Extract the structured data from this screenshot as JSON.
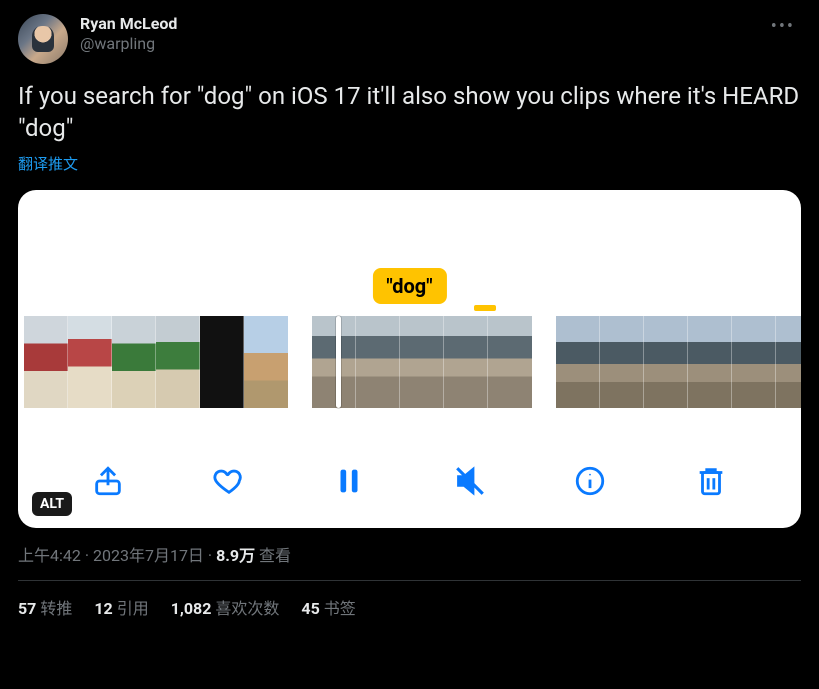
{
  "author": {
    "display_name": "Ryan McLeod",
    "username": "@warpling"
  },
  "tweet_text": "If you search for \"dog\" on iOS 17 it'll also show you clips where it's HEARD \"dog\"",
  "translate_label": "翻译推文",
  "media": {
    "search_badge": "\"dog\"",
    "alt_label": "ALT"
  },
  "meta": {
    "time": "上午4:42",
    "date": "2023年7月17日",
    "views_number": "8.9万",
    "views_suffix": "查看"
  },
  "stats": {
    "retweets_num": "57",
    "retweets_label": "转推",
    "quotes_num": "12",
    "quotes_label": "引用",
    "likes_num": "1,082",
    "likes_label": "喜欢次数",
    "bookmarks_num": "45",
    "bookmarks_label": "书签"
  }
}
